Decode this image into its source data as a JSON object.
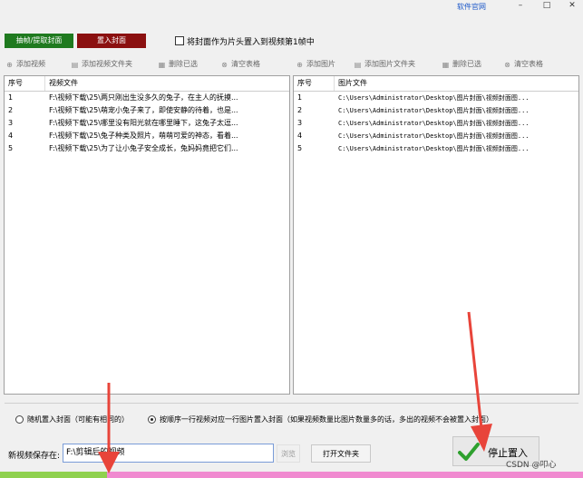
{
  "titlebar": {
    "site_link": "软件官网",
    "min": "–",
    "max": "□",
    "close": "✕"
  },
  "top_buttons": {
    "extract_cover": "抽帧/提取封面",
    "insert_cover": "置入封面",
    "first_frame_checkbox_label": "将封面作为片头置入到视频第1帧中"
  },
  "left_toolbar": {
    "add_video": "添加视频",
    "add_video_folder": "添加视频文件夹",
    "delete_selected": "删除已选",
    "clear_table": "清空表格"
  },
  "right_toolbar": {
    "add_image": "添加图片",
    "add_image_folder": "添加图片文件夹",
    "delete_selected": "删除已选",
    "clear_table": "清空表格"
  },
  "video_table": {
    "col_index": "序号",
    "col_file": "视频文件",
    "rows": [
      {
        "index": "1",
        "file": "F:\\视频下载\\25\\两只刚出生没多久的兔子，在主人的抚摸..."
      },
      {
        "index": "2",
        "file": "F:\\视频下载\\25\\萌宠小兔子来了，即使安静的待着，也是..."
      },
      {
        "index": "3",
        "file": "F:\\视频下载\\25\\哪里没有阳光就在哪里睡下，这兔子太逗..."
      },
      {
        "index": "4",
        "file": "F:\\视频下载\\25\\兔子种类及照片，萌萌可爱的神态，看着..."
      },
      {
        "index": "5",
        "file": "F:\\视频下载\\25\\为了让小兔子安全成长，兔妈妈竟把它们..."
      }
    ]
  },
  "image_table": {
    "col_index": "序号",
    "col_file": "图片文件",
    "rows": [
      {
        "index": "1",
        "file": "C:\\Users\\Administrator\\Desktop\\图片封面\\视频封面图..."
      },
      {
        "index": "2",
        "file": "C:\\Users\\Administrator\\Desktop\\图片封面\\视频封面图..."
      },
      {
        "index": "3",
        "file": "C:\\Users\\Administrator\\Desktop\\图片封面\\视频封面图..."
      },
      {
        "index": "4",
        "file": "C:\\Users\\Administrator\\Desktop\\图片封面\\视频封面图..."
      },
      {
        "index": "5",
        "file": "C:\\Users\\Administrator\\Desktop\\图片封面\\视频封面图..."
      }
    ]
  },
  "options": {
    "random_insert": "随机置入封面（可能有相同的）",
    "sequential_insert": "按顺序一行视频对应一行图片置入封面（如果视频数量比图片数量多的话，多出的视频不会被置入封面）"
  },
  "save": {
    "label": "新视频保存在:",
    "path": "F:\\剪辑后的视频",
    "browse": "浏览",
    "open_folder": "打开文件夹",
    "stop": "停止置入"
  },
  "watermark": "CSDN @叩心",
  "colors": {
    "extract_btn": "#1f7a1f",
    "insert_btn": "#8b1010",
    "progress_done": "#8fd14f",
    "progress_rest": "#f08ad0",
    "arrow": "#e8443a"
  },
  "progress_fraction": 0.18
}
